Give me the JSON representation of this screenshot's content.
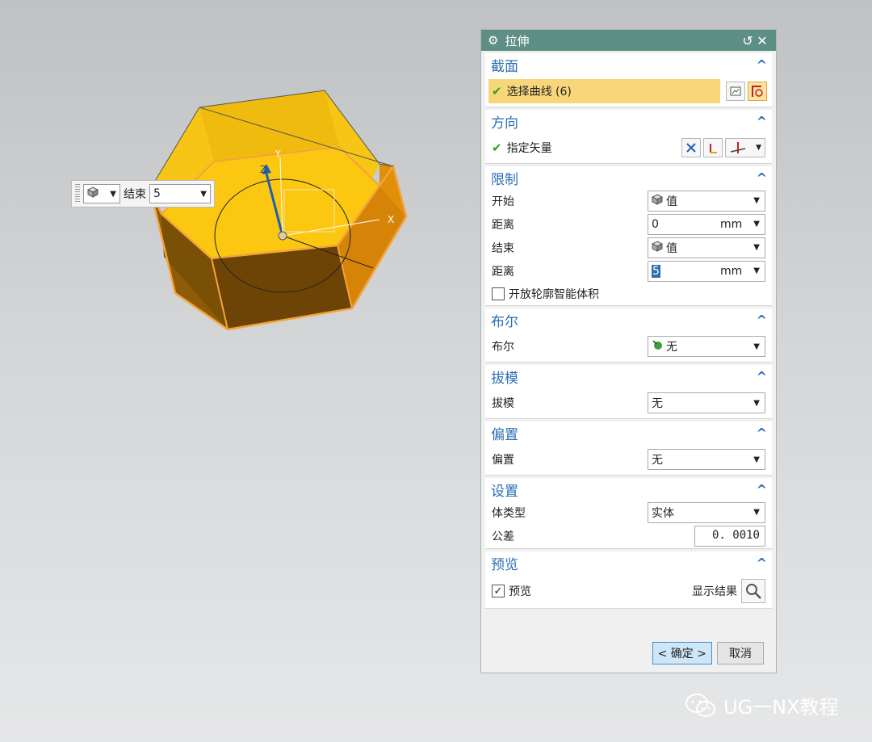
{
  "float_input": {
    "label": "结束",
    "value": "5"
  },
  "axes": {
    "x": "X",
    "y": "Y",
    "z": "Z"
  },
  "dialog": {
    "title": "拉伸",
    "sections": {
      "section_cut": {
        "title": "截面",
        "select_curve": "选择曲线 (6)"
      },
      "direction": {
        "title": "方向",
        "specify_vector": "指定矢量"
      },
      "limits": {
        "title": "限制",
        "start_label": "开始",
        "start_value": "值",
        "dist1_label": "距离",
        "dist1_value": "0",
        "dist1_unit": "mm",
        "end_label": "结束",
        "end_value": "值",
        "dist2_label": "距离",
        "dist2_value": "5",
        "dist2_unit": "mm",
        "open_profile": "开放轮廓智能体积"
      },
      "boolean": {
        "title": "布尔",
        "label": "布尔",
        "value": "无"
      },
      "draft": {
        "title": "拔模",
        "label": "拔模",
        "value": "无"
      },
      "offset": {
        "title": "偏置",
        "label": "偏置",
        "value": "无"
      },
      "settings": {
        "title": "设置",
        "body_type_label": "体类型",
        "body_type_value": "实体",
        "tolerance_label": "公差",
        "tolerance_value": "0. 0010"
      },
      "preview": {
        "title": "预览",
        "checkbox_label": "预览",
        "show_result": "显示结果"
      }
    },
    "ok": "< 确定 >",
    "cancel": "取消"
  },
  "watermark": "UG一NX教程"
}
